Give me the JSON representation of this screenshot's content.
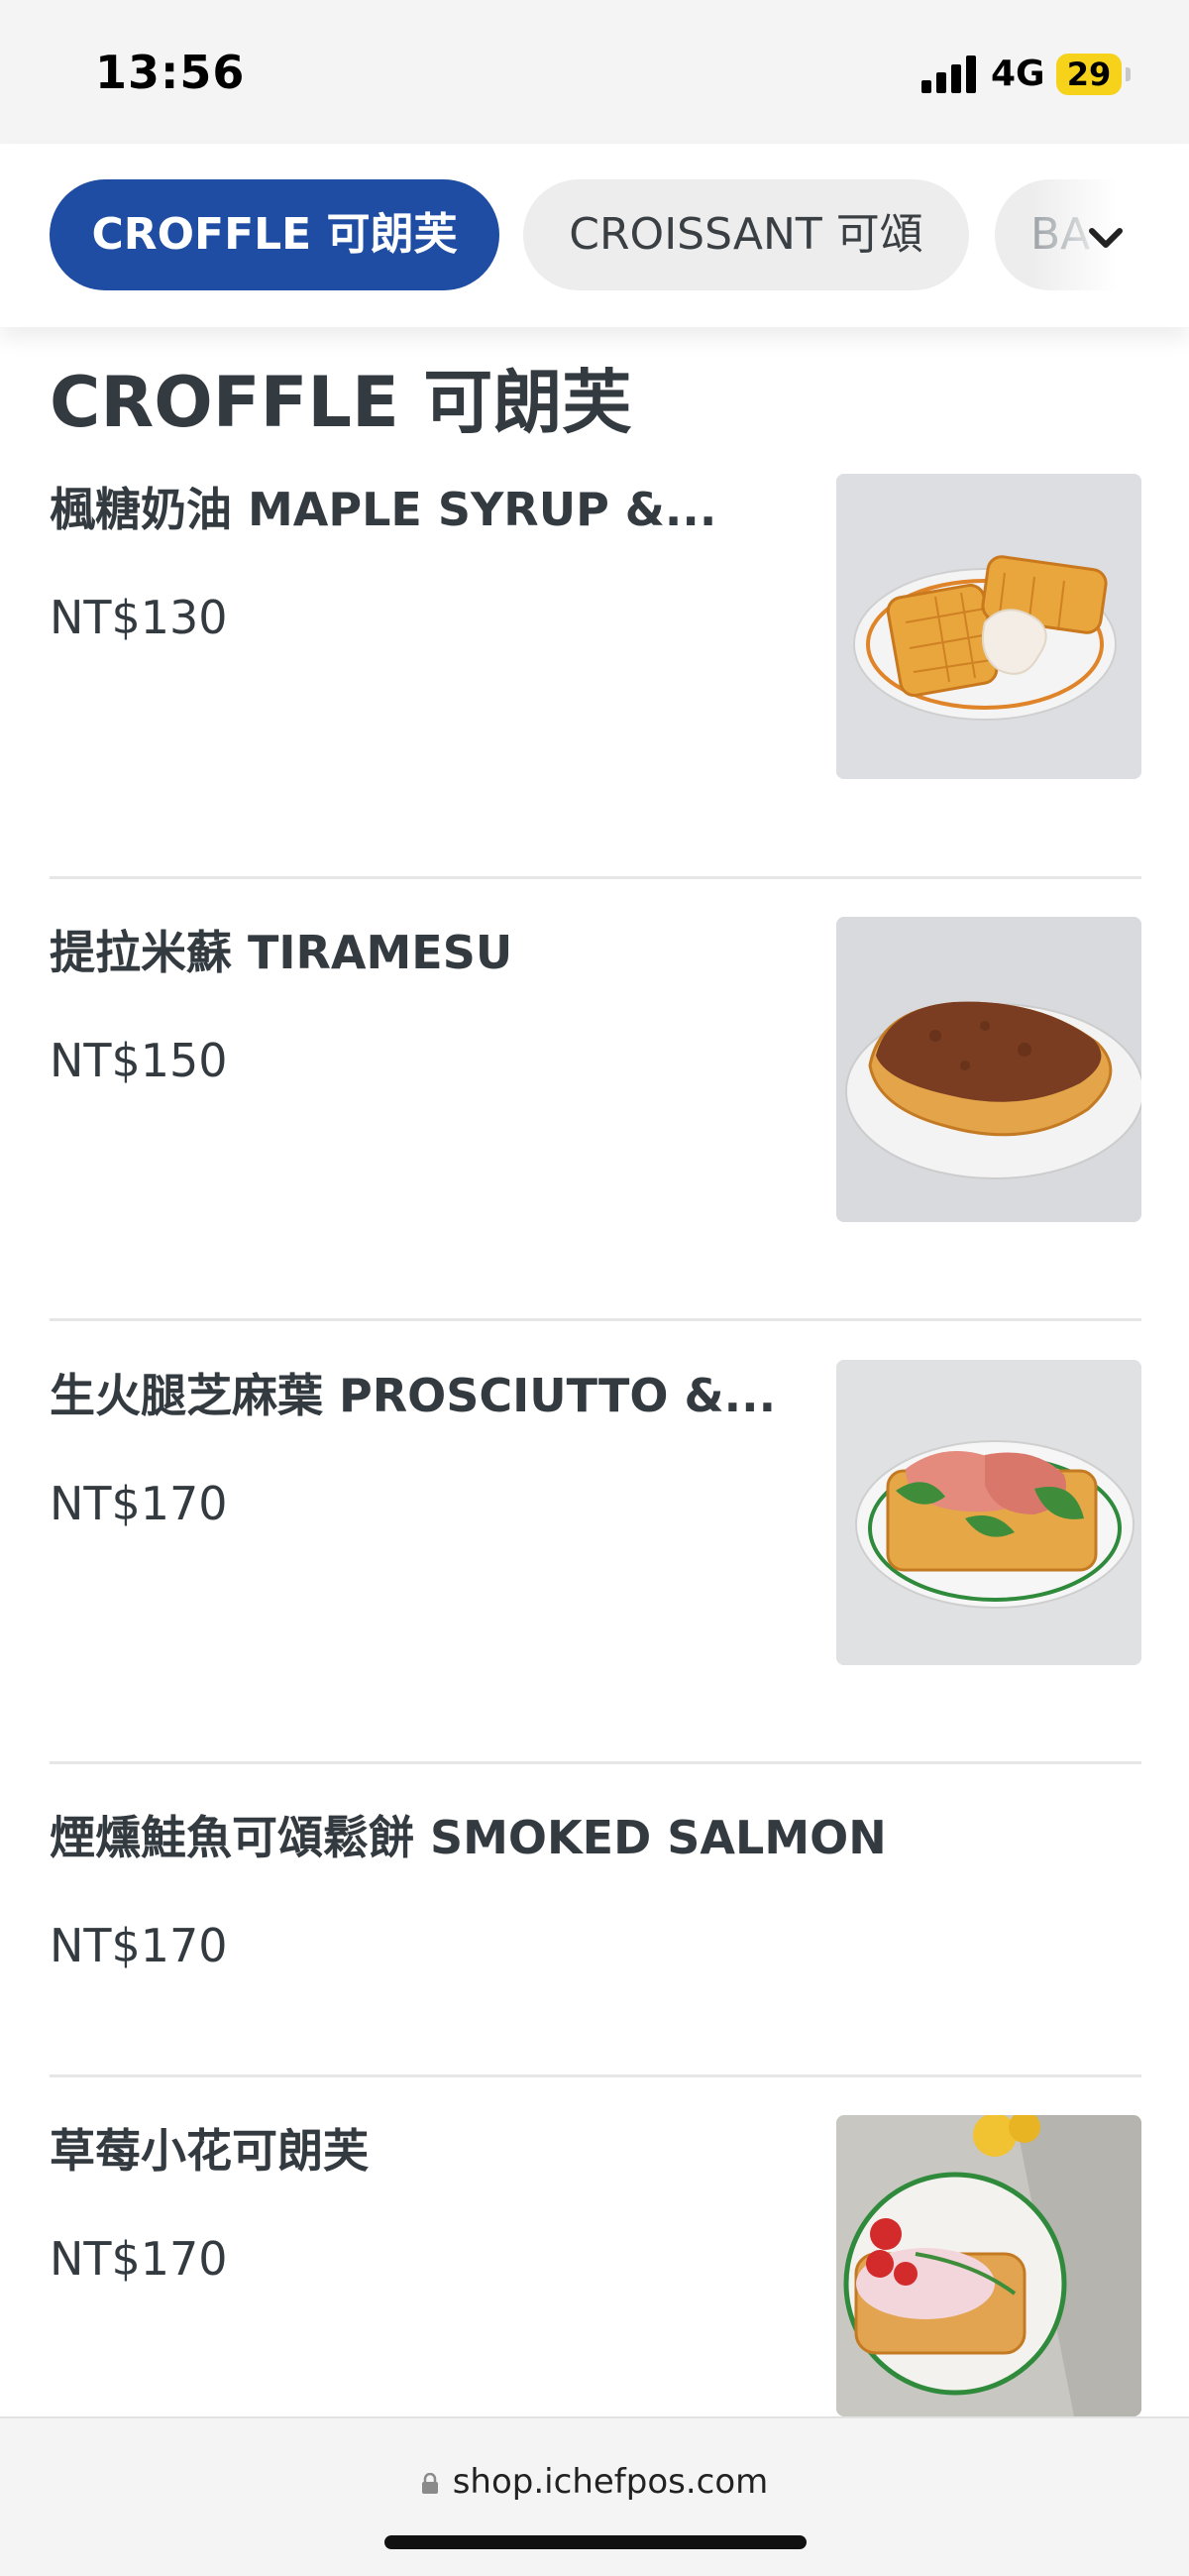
{
  "status_bar": {
    "time": "13:56",
    "network": "4G",
    "battery": "29"
  },
  "tabs": [
    {
      "label": "CROFFLE 可朗芙",
      "active": true
    },
    {
      "label": "CROISSANT 可頌",
      "active": false
    },
    {
      "label": "BA",
      "active": false
    }
  ],
  "section": {
    "title": "CROFFLE 可朗芙"
  },
  "items": [
    {
      "name": "楓糖奶油 MAPLE SYRUP &...",
      "price": "NT$130",
      "photo": "croffle-maple-butter-photo"
    },
    {
      "name": "提拉米蘇 TIRAMESU",
      "price": "NT$150",
      "photo": "croffle-tiramisu-photo"
    },
    {
      "name": "生火腿芝麻葉 PROSCIUTTO &...",
      "price": "NT$170",
      "photo": "croffle-prosciutto-photo"
    },
    {
      "name": "煙燻鮭魚可頌鬆餅 SMOKED SALMON",
      "price": "NT$170",
      "photo": null
    },
    {
      "name": "草莓小花可朗芙",
      "price": "NT$170",
      "photo": "croffle-strawberry-photo"
    }
  ],
  "browser": {
    "url": "shop.ichefpos.com"
  },
  "colors": {
    "accent": "#1f4da3",
    "text": "#333a40",
    "chip": "#ededed",
    "battery": "#f6d21b"
  },
  "icons": [
    "signal-icon",
    "battery-icon",
    "chevron-down-icon",
    "lock-icon"
  ]
}
